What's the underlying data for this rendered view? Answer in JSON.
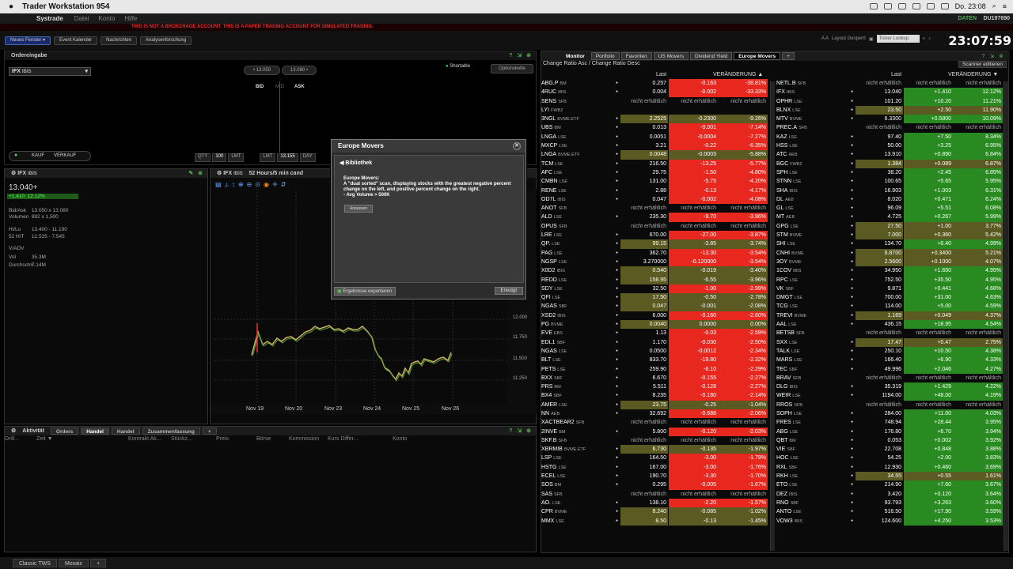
{
  "menubar": {
    "apple": "",
    "app": "Trader Workstation 954",
    "right": "Do. 23:08"
  },
  "apphdr": {
    "systrade": "Systrade",
    "menu": [
      "Datei",
      "Konto",
      "Hilfe"
    ],
    "daten": "DATEN",
    "account": "DU197690"
  },
  "warning": "THIS IS NOT A BROKERAGE ACCOUNT. THIS IS A PAPER TRADING ACCOUNT FOR SIMULATED TRADING.",
  "toolbar": {
    "new_window": "Neues Fenster ▾",
    "buttons": [
      "Event Kalender",
      "Nachrichten",
      "Analysenforschung"
    ],
    "layout": "Layout Gesperrt",
    "aa": "A A",
    "ticker_placeholder": "Ticker Lookup",
    "clock": "23:07:59"
  },
  "order": {
    "title": "Ordereingabe",
    "symbol": "IFX",
    "exchange": "IBIS",
    "bid": "13.050",
    "ask": "13.080",
    "bid_label": "BID",
    "mid_label": "MID",
    "ask_label": "ASK",
    "shortable": "Shortable",
    "optionskette": "Optionskette",
    "kauf": "KAUF",
    "verkauf": "VERKAUF",
    "qty_label": "QTY",
    "qty": "100",
    "lmt": "LMT",
    "lmt_label": "LMT",
    "price": "13.155",
    "day": "DAY"
  },
  "quote": {
    "title": "IFX",
    "exchange": "IBIS",
    "last": "13.040+",
    "chg": "+1.410",
    "chgpct": "12.12%",
    "bidask_label": "Bid/Ask",
    "bidask": "13.050 x 13.080",
    "vol_label": "Volumen",
    "vol": "892 x 1,500",
    "hilo_label": "Hi/Lo",
    "hilo": "13.400 - 11.190",
    "w52_label": "52 H/T",
    "w52": "12.525 - 7.545",
    "vadv_label": "V/ADV",
    "vol2_label": "Vol",
    "vol2": "35.3M",
    "avg_label": "Durchschn.",
    "avg": "7.14M"
  },
  "chart": {
    "title": "IFX",
    "exchange": "IBIS",
    "period": "52 Hours/5 min cand",
    "y_ticks": [
      "12.000",
      "11.750",
      "11.500",
      "11.250"
    ],
    "x_ticks": [
      "Nov 19",
      "Nov 20",
      "Nov 23",
      "Nov 24",
      "Nov 25",
      "Nov 26"
    ]
  },
  "dialog": {
    "title": "Europe Movers",
    "back": "Bibliothek",
    "name": "Europe Movers:",
    "desc": "A \"dual sorted\" scan, displaying stocks with the greatest negative percent change on the left, and positive percent change on the right.",
    "filter": "- Avg Volume > 500K",
    "apply": "Anpassen",
    "export": "Ergebnisse exportieren",
    "done": "Erledigt"
  },
  "activity": {
    "title": "Aktivität",
    "tabs": [
      "Orders",
      "Handel",
      "Handel",
      "Zusammenfassung"
    ],
    "cols": [
      "Drill...",
      "Zeit ▼",
      "Kontrakt Ak...",
      "Stückz...",
      "Preis",
      "Börse",
      "Kommission",
      "Kurs Differ...",
      "Konto"
    ]
  },
  "monitor": {
    "tabs": [
      "Monitor",
      "Portfolio",
      "Favoriten",
      "US Movers",
      "Dividend Yield",
      "Europe Movers"
    ],
    "subtitle": "Change Ratio Asc / Change Ratio Desc",
    "scanner_btn": "Scanner editieren",
    "col_last": "Last",
    "col_chg": "VERÄNDERUNG ▲",
    "col_chg_r": "VERÄNDERUNG ▼",
    "left": [
      [
        "ABG.P",
        "BM",
        "0.257",
        "-0.163",
        "-38.81%",
        "r"
      ],
      [
        "4RUC",
        "IBIS",
        "0.004",
        "-0.002",
        "-33.33%",
        "r"
      ],
      [
        "SENS",
        "SFB",
        "nicht erhältlich",
        "nicht erhältlich",
        "nicht erhältlich",
        "n"
      ],
      [
        "LYI",
        "FWB2",
        "",
        "",
        "",
        "e"
      ],
      [
        "3NGL",
        "BVME.ETF",
        "2.2525",
        "-0.2300",
        "-9.26%",
        "o"
      ],
      [
        "UBS",
        "BM",
        "0.013",
        "-0.001",
        "-7.14%",
        "r"
      ],
      [
        "LNGA",
        "LSE",
        "0.0051",
        "-0.0004",
        "-7.27%",
        "r"
      ],
      [
        "MXCP",
        "LSE",
        "3.21",
        "-0.22",
        "-6.35%",
        "r"
      ],
      [
        "LNGA",
        "BVME.ETF",
        "0.0048",
        "-0.0003",
        "-5.88%",
        "o"
      ],
      [
        "TCM",
        "LSE",
        "216.50",
        "-13.25",
        "-5.77%",
        "r"
      ],
      [
        "AFC",
        "LSE",
        "29.75",
        "-1.50",
        "-4.80%",
        "r"
      ],
      [
        "CMBN",
        "LSE",
        "131.00",
        "-5.75",
        "-4.20%",
        "r"
      ],
      [
        "RENE",
        "LSE",
        "2.88",
        "-0.13",
        "-4.17%",
        "r"
      ],
      [
        "OD7L",
        "IBIS",
        "0.047",
        "-0.002",
        "-4.08%",
        "r"
      ],
      [
        "ANOT",
        "SFB",
        "nicht erhältlich",
        "nicht erhältlich",
        "nicht erhältlich",
        "n"
      ],
      [
        "ALD",
        "LSE",
        "235.30",
        "-9.70",
        "-3.96%",
        "r"
      ],
      [
        "OPUS",
        "SFB",
        "nicht erhältlich",
        "nicht erhältlich",
        "nicht erhältlich",
        "n"
      ],
      [
        "LRE",
        "LSE",
        "670.00",
        "-27.00",
        "-3.87%",
        "r"
      ],
      [
        "QP.",
        "LSE",
        "99.15",
        "-3.85",
        "-3.74%",
        "o"
      ],
      [
        "PAG",
        "LSE",
        "362.70",
        "-13.30",
        "-3.54%",
        "r"
      ],
      [
        "NGSP",
        "LSE",
        "3.270000",
        "-0.120000",
        "-3.54%",
        "r"
      ],
      [
        "X0D2",
        "IBIS",
        "0.540",
        "-0.019",
        "-3.40%",
        "o"
      ],
      [
        "REDD",
        "LSE",
        "158.95",
        "-6.55",
        "-3.96%",
        "o"
      ],
      [
        "SDY",
        "LSE",
        "32.50",
        "-1.00",
        "-2.99%",
        "r"
      ],
      [
        "QFI",
        "LSE",
        "17.50",
        "-0.50",
        "-2.78%",
        "o"
      ],
      [
        "NGAS",
        "SBF",
        "0.047",
        "-0.001",
        "-2.08%",
        "o"
      ],
      [
        "XSD2",
        "IBIS",
        "6.000",
        "-0.160",
        "-2.60%",
        "r"
      ],
      [
        "PG",
        "BVME",
        "0.0040",
        "0.0000",
        "0.00%",
        "o"
      ],
      [
        "EVE",
        "EBS",
        "1.13",
        "-0.03",
        "-2.59%",
        "r"
      ],
      [
        "EDL1",
        "SBF",
        "1.170",
        "-0.030",
        "-2.50%",
        "r"
      ],
      [
        "NGAS",
        "LSE",
        "0.0500",
        "-0.0012",
        "-2.34%",
        "r"
      ],
      [
        "BLT",
        "LSE",
        "833.70",
        "-19.80",
        "-2.32%",
        "r"
      ],
      [
        "PETS",
        "LSE",
        "259.90",
        "-6.10",
        "-2.29%",
        "r"
      ],
      [
        "BXX",
        "SBF",
        "6.670",
        "-0.155",
        "-2.27%",
        "r"
      ],
      [
        "PRS",
        "BM",
        "5.511",
        "-0.128",
        "-2.27%",
        "r"
      ],
      [
        "BX4",
        "SBF",
        "8.235",
        "-0.180",
        "-2.14%",
        "r"
      ],
      [
        "AMER",
        "LSE",
        "23.75",
        "-0.25",
        "-1.04%",
        "o"
      ],
      [
        "NN",
        "AEB",
        "32.692",
        "-0.688",
        "-2.06%",
        "r"
      ],
      [
        "XACTBEAR2",
        "SFB",
        "nicht erhältlich",
        "nicht erhältlich",
        "nicht erhältlich",
        "n"
      ],
      [
        "2INVE",
        "BM",
        "5.800",
        "-0.120",
        "-2.03%",
        "r"
      ],
      [
        "SKF.B",
        "SFB",
        "nicht erhältlich",
        "nicht erhältlich",
        "nicht erhältlich",
        "n"
      ],
      [
        "XBRMIB",
        "BVME.ETF",
        "6.730",
        "-0.135",
        "-1.97%",
        "o"
      ],
      [
        "LSP",
        "LSE",
        "164.50",
        "-3.00",
        "-1.79%",
        "r"
      ],
      [
        "HSTG",
        "LSE",
        "167.00",
        "-3.00",
        "-1.76%",
        "r"
      ],
      [
        "ECEL",
        "LSE",
        "190.70",
        "-3.30",
        "-1.70%",
        "r"
      ],
      [
        "SOS",
        "BM",
        "0.295",
        "-0.005",
        "-1.67%",
        "r"
      ],
      [
        "SAS",
        "SFB",
        "nicht erhältlich",
        "nicht erhältlich",
        "nicht erhältlich",
        "n"
      ],
      [
        "AO.",
        "LSE",
        "138.10",
        "-2.20",
        "-1.57%",
        "r"
      ],
      [
        "CPR",
        "BVME",
        "8.240",
        "-0.085",
        "-1.02%",
        "o"
      ],
      [
        "MMX",
        "LSE",
        "8.50",
        "-0.13",
        "-1.45%",
        "o"
      ]
    ],
    "right": [
      [
        "NETL.B",
        "SFB",
        "nicht erhältlich",
        "nicht erhältlich",
        "nicht erhältlich",
        "n"
      ],
      [
        "IFX",
        "IBIS",
        "13.040",
        "+1.410",
        "12.12%",
        "g"
      ],
      [
        "OPHR",
        "LSE",
        "101.20",
        "+10.20",
        "11.21%",
        "g"
      ],
      [
        "BLNX",
        "LSE",
        "23.50",
        "+2.50",
        "11.90%",
        "o"
      ],
      [
        "MTV",
        "BVME",
        "6.3300",
        "+0.5800",
        "10.09%",
        "g"
      ],
      [
        "PREC.A",
        "SFB",
        "nicht erhältlich",
        "nicht erhältlich",
        "nicht erhältlich",
        "n"
      ],
      [
        "KAZ",
        "LSE",
        "97.40",
        "+7.50",
        "8.34%",
        "g"
      ],
      [
        "HSS",
        "LSE",
        "50.00",
        "+3.25",
        "6.95%",
        "g"
      ],
      [
        "ATC",
        "AEB",
        "13.910",
        "+0.890",
        "6.84%",
        "g"
      ],
      [
        "BGC",
        "FWB2",
        "1.384",
        "+0.089",
        "6.87%",
        "o"
      ],
      [
        "SPH",
        "LSE",
        "38.20",
        "+2.45",
        "6.85%",
        "g"
      ],
      [
        "STNN",
        "LSE",
        "100.65",
        "+5.65",
        "5.95%",
        "g"
      ],
      [
        "SHA",
        "IBIS",
        "16.903",
        "+1.003",
        "6.31%",
        "g"
      ],
      [
        "DL",
        "AEB",
        "8.020",
        "+0.471",
        "6.24%",
        "g"
      ],
      [
        "GL",
        "LSE",
        "96.09",
        "+5.51",
        "6.08%",
        "g"
      ],
      [
        "MT",
        "AEB",
        "4.725",
        "+0.267",
        "5.99%",
        "g"
      ],
      [
        "GPG",
        "LSE",
        "27.50",
        "+1.00",
        "3.77%",
        "o"
      ],
      [
        "STM",
        "BVME",
        "7.000",
        "+0.360",
        "5.42%",
        "o"
      ],
      [
        "SHI",
        "LSE",
        "134.70",
        "+6.40",
        "4.99%",
        "g"
      ],
      [
        "CNHI",
        "BVME",
        "6.8700",
        "+0.3400",
        "5.21%",
        "o"
      ],
      [
        "3OY",
        "BVME",
        "2.5600",
        "+0.1000",
        "4.07%",
        "o"
      ],
      [
        "1COV",
        "IBIS",
        "34.950",
        "+1.650",
        "4.95%",
        "g"
      ],
      [
        "RPC",
        "LSE",
        "752.50",
        "+35.50",
        "4.95%",
        "g"
      ],
      [
        "VK",
        "SBF",
        "9.871",
        "+0.441",
        "4.68%",
        "g"
      ],
      [
        "DMGT",
        "LSE",
        "700.00",
        "+31.00",
        "4.63%",
        "g"
      ],
      [
        "TCG",
        "LSE",
        "114.00",
        "+5.00",
        "4.59%",
        "g"
      ],
      [
        "TREVI",
        "BVME",
        "1.169",
        "+0.049",
        "4.37%",
        "o"
      ],
      [
        "AAL",
        "LSE",
        "436.15",
        "+18.95",
        "4.54%",
        "g"
      ],
      [
        "BETSB",
        "SFB",
        "nicht erhältlich",
        "nicht erhältlich",
        "nicht erhältlich",
        "n"
      ],
      [
        "SXX",
        "LSE",
        "17.47",
        "+0.47",
        "2.75%",
        "o"
      ],
      [
        "TALK",
        "LSE",
        "250.10",
        "+10.50",
        "4.38%",
        "g"
      ],
      [
        "MARS",
        "LSE",
        "166.40",
        "+6.90",
        "4.33%",
        "g"
      ],
      [
        "TEC",
        "SBF",
        "49.996",
        "+2.046",
        "4.27%",
        "g"
      ],
      [
        "BRAV",
        "SFB",
        "nicht erhältlich",
        "nicht erhältlich",
        "nicht erhältlich",
        "n"
      ],
      [
        "DLG",
        "IBIS",
        "35.319",
        "+1.429",
        "4.22%",
        "g"
      ],
      [
        "WEIR",
        "LSE",
        "1194.00",
        "+48.00",
        "4.19%",
        "g"
      ],
      [
        "RROS",
        "SFB",
        "nicht erhältlich",
        "nicht erhältlich",
        "nicht erhältlich",
        "n"
      ],
      [
        "SOPH",
        "LSE",
        "284.00",
        "+11.00",
        "4.03%",
        "g"
      ],
      [
        "FRES",
        "LSE",
        "748.94",
        "+28.44",
        "3.95%",
        "g"
      ],
      [
        "ABG",
        "LSE",
        "176.80",
        "+6.70",
        "3.94%",
        "g"
      ],
      [
        "QBT",
        "BM",
        "0.053",
        "+0.002",
        "3.92%",
        "g"
      ],
      [
        "VIE",
        "SBF",
        "22.708",
        "+0.848",
        "3.88%",
        "g"
      ],
      [
        "HOC",
        "LSE",
        "54.25",
        "+2.00",
        "3.83%",
        "g"
      ],
      [
        "RXL",
        "SBF",
        "12.930",
        "+0.460",
        "3.69%",
        "g"
      ],
      [
        "RKH",
        "LSE",
        "34.55",
        "+0.55",
        "1.61%",
        "o"
      ],
      [
        "ETO",
        "LSE",
        "214.90",
        "+7.60",
        "3.67%",
        "g"
      ],
      [
        "DEZ",
        "IBIS",
        "3.420",
        "+0.120",
        "3.64%",
        "g"
      ],
      [
        "RNO",
        "SBF",
        "93.793",
        "+3.263",
        "3.60%",
        "g"
      ],
      [
        "ANTO",
        "LSE",
        "516.50",
        "+17.90",
        "3.59%",
        "g"
      ],
      [
        "VOW3",
        "IBIS",
        "124.600",
        "+4.250",
        "3.53%",
        "g"
      ]
    ]
  },
  "bottom": {
    "tabs": [
      "Classic TWS",
      "Mosaic",
      "+"
    ]
  },
  "colors": {
    "red": "#e8281e",
    "olive": "#5a5a22",
    "green": "#2a8a22",
    "na": "#1a1a1a"
  }
}
